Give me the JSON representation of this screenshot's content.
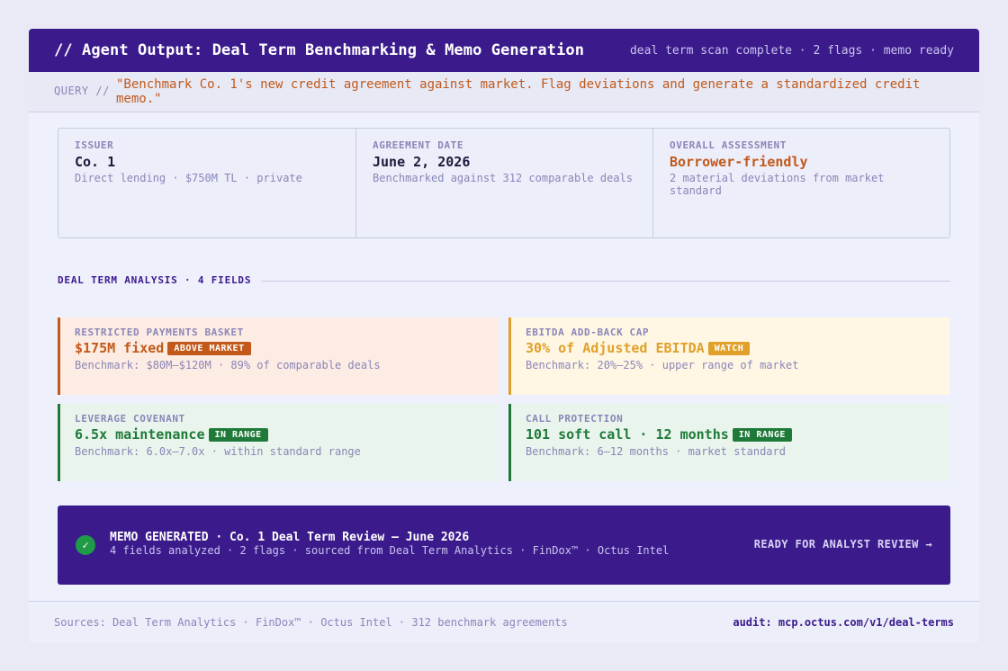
{
  "header": {
    "title": "// Agent Output: Deal Term Benchmarking & Memo Generation",
    "status": "deal term scan complete · 2 flags · memo ready"
  },
  "query": {
    "label": "QUERY //",
    "text": "\"Benchmark Co. 1's new credit agreement against market. Flag deviations and generate a standardized credit memo.\""
  },
  "summary": [
    {
      "label": "ISSUER",
      "value": "Co. 1",
      "sub": "Direct lending · $750M TL · private"
    },
    {
      "label": "AGREEMENT DATE",
      "value": "June 2, 2026",
      "sub": "Benchmarked against 312 comparable deals"
    },
    {
      "label": "OVERALL ASSESSMENT",
      "value": "Borrower-friendly",
      "sub": "2 material deviations from market standard"
    }
  ],
  "section": {
    "title": "DEAL TERM ANALYSIS · 4 FIELDS"
  },
  "fields": [
    {
      "label": "RESTRICTED PAYMENTS BASKET",
      "value": "$175M fixed",
      "badge": "ABOVE MARKET",
      "benchmark": "Benchmark: $80M–$120M · 89% of comparable deals",
      "color": "#c2591a"
    },
    {
      "label": "EBITDA ADD-BACK CAP",
      "value": "30% of Adjusted EBITDA",
      "badge": "WATCH",
      "benchmark": "Benchmark: 20%–25% · upper range of market",
      "color": "#e0a02a"
    },
    {
      "label": "LEVERAGE COVENANT",
      "value": "6.5x maintenance",
      "badge": "IN RANGE",
      "benchmark": "Benchmark: 6.0x–7.0x · within standard range",
      "color": "#1f7a3a"
    },
    {
      "label": "CALL PROTECTION",
      "value": "101 soft call · 12 months",
      "badge": "IN RANGE",
      "benchmark": "Benchmark: 6–12 months · market standard",
      "color": "#1f7a3a"
    }
  ],
  "memo": {
    "check": "✓",
    "title": "MEMO GENERATED · Co. 1 Deal Term Review — June 2026",
    "sub": "4 fields analyzed · 2 flags · sourced from Deal Term Analytics · FinDox™ · Octus Intel",
    "cta": "READY FOR ANALYST REVIEW →"
  },
  "footer": {
    "sources": "Sources: Deal Term Analytics · FinDox™ · Octus Intel · 312 benchmark agreements",
    "audit": "audit: mcp.octus.com/v1/deal-terms"
  },
  "colors": {
    "brand": "#3b1b8c",
    "flag": "#c2591a",
    "watch": "#e0a02a",
    "ok": "#1f7a3a"
  }
}
